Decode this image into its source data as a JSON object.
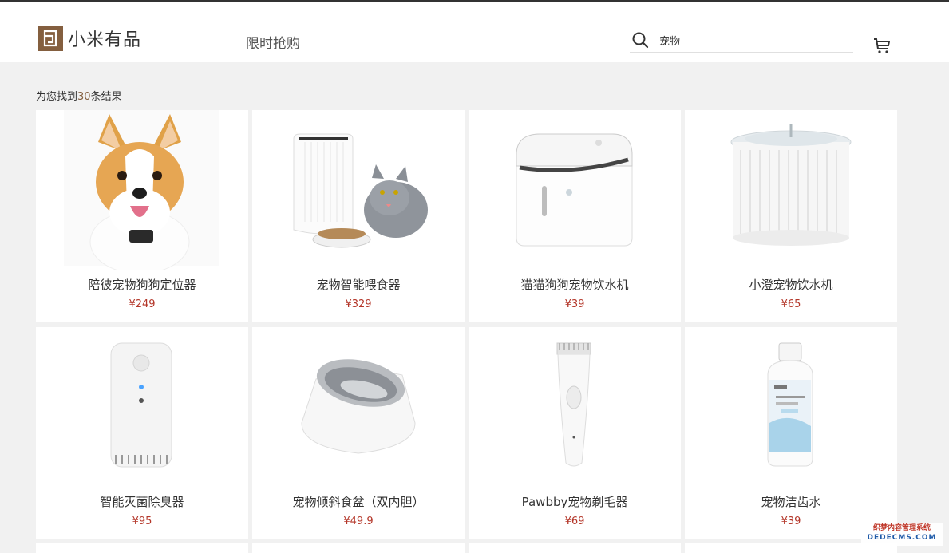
{
  "header": {
    "logo_text": "小米有品",
    "nav_link": "限时抢购",
    "search_value": "宠物"
  },
  "results": {
    "prefix": "为您找到",
    "count": "30",
    "suffix": "条结果"
  },
  "products": [
    {
      "title": "陪彼宠物狗狗定位器",
      "price": "¥249",
      "image": "corgi-with-tracker"
    },
    {
      "title": "宠物智能喂食器",
      "price": "¥329",
      "image": "feeder-with-cat"
    },
    {
      "title": "猫猫狗狗宠物饮水机",
      "price": "¥39",
      "image": "water-dispenser"
    },
    {
      "title": "小澄宠物饮水机",
      "price": "¥65",
      "image": "water-fountain"
    },
    {
      "title": "智能灭菌除臭器",
      "price": "¥95",
      "image": "deodorizer"
    },
    {
      "title": "宠物倾斜食盆（双内胆）",
      "price": "¥49.9",
      "image": "tilted-bowl"
    },
    {
      "title": "Pawbby宠物剃毛器",
      "price": "¥69",
      "image": "hair-clipper"
    },
    {
      "title": "宠物洁齿水",
      "price": "¥39",
      "image": "dental-water"
    }
  ],
  "watermark": {
    "line1": "织梦内容管理系统",
    "line2": "DEDECMS.COM"
  },
  "colors": {
    "brand": "#845f3f",
    "price": "#b4372a",
    "background": "#f1f1f1"
  }
}
